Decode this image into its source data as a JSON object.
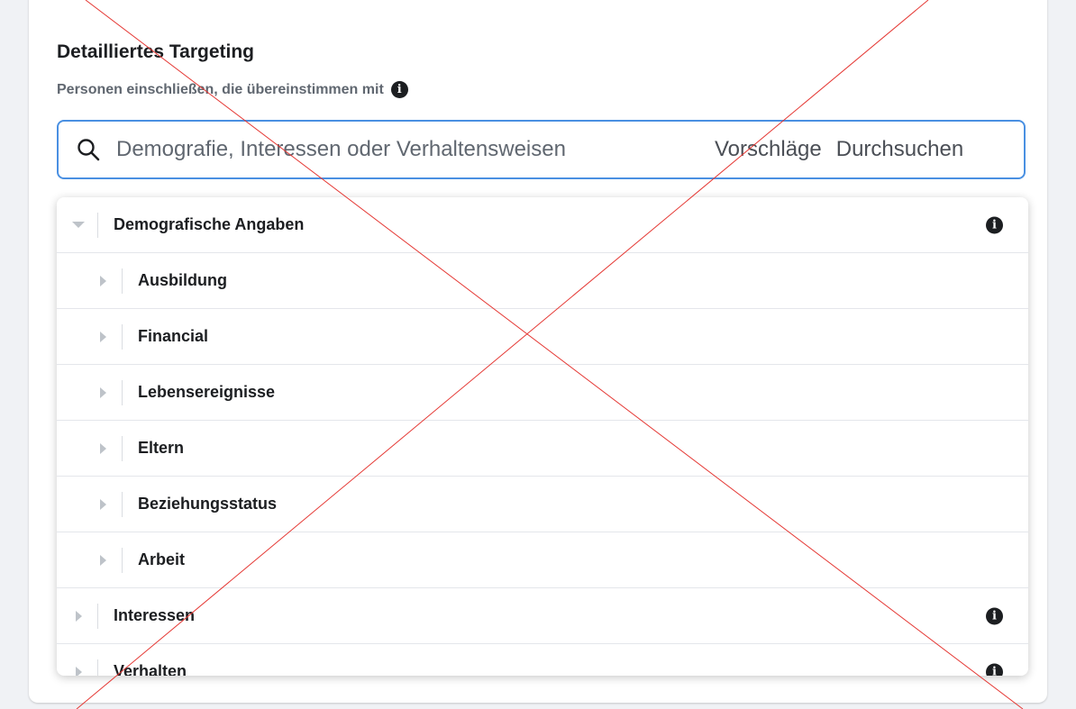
{
  "section": {
    "title": "Detailliertes Targeting",
    "subtitle": "Personen einschließen, die übereinstimmen mit",
    "info_glyph": "i"
  },
  "search": {
    "placeholder": "Demografie, Interessen oder Verhaltensweisen",
    "value": "",
    "suggestions_label": "Vorschläge",
    "browse_label": "Durchsuchen"
  },
  "tree": {
    "demographics": {
      "label": "Demografische Angaben",
      "expanded": true
    },
    "demographics_children": [
      {
        "label": "Ausbildung"
      },
      {
        "label": "Financial"
      },
      {
        "label": "Lebensereignisse"
      },
      {
        "label": "Eltern"
      },
      {
        "label": "Beziehungsstatus"
      },
      {
        "label": "Arbeit"
      }
    ],
    "interests": {
      "label": "Interessen"
    },
    "behaviors": {
      "label": "Verhalten"
    }
  },
  "icons": {
    "search": "search-icon",
    "info": "info-icon",
    "collapsed": "caret-right-icon",
    "expanded": "caret-down-icon"
  },
  "colors": {
    "focus_border": "#4a90e2",
    "overlay_cross": "#e53935"
  }
}
